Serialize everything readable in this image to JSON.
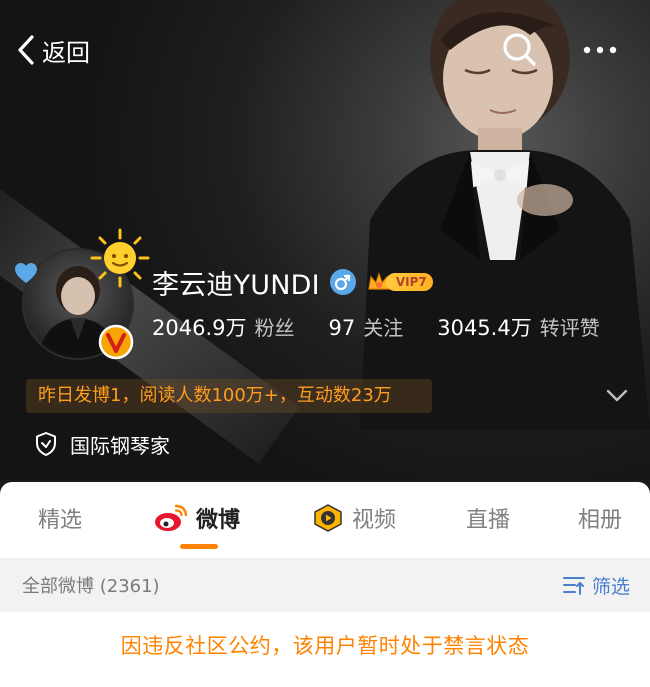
{
  "topbar": {
    "back_label": "返回"
  },
  "profile": {
    "name": "李云迪YUNDI",
    "vip_label": "VIP7",
    "stats": [
      {
        "value": "2046.9万",
        "label": "粉丝"
      },
      {
        "value": "97",
        "label": "关注"
      },
      {
        "value": "3045.4万",
        "label": "转评赞"
      }
    ],
    "activity": "昨日发博1，阅读人数100万+，互动数23万",
    "certification": "国际钢琴家"
  },
  "tabs": [
    {
      "label": "精选",
      "active": false
    },
    {
      "label": "微博",
      "active": true
    },
    {
      "label": "视频",
      "active": false
    },
    {
      "label": "直播",
      "active": false
    },
    {
      "label": "相册",
      "active": false
    }
  ],
  "feed": {
    "count_label": "全部微博 (2361)",
    "filter_label": "筛选",
    "ban_message": "因违反社区公约，该用户暂时处于禁言状态"
  },
  "colors": {
    "accent": "#ff8200",
    "link_blue": "#4b7ecf",
    "gender_blue": "#5aa8e8"
  },
  "icons": {
    "back": "chevron-left-icon",
    "search": "search-icon",
    "more": "more-dots-icon",
    "sun": "sun-badge-icon",
    "heart": "blue-heart-icon",
    "verified": "verified-v-icon",
    "gender": "male-gender-icon",
    "vip_crown": "crown-icon",
    "expand": "chevron-down-icon",
    "shield": "shield-check-icon",
    "weibo_tab": "weibo-logo-icon",
    "video_tab": "video-play-icon",
    "filter": "filter-icon"
  }
}
